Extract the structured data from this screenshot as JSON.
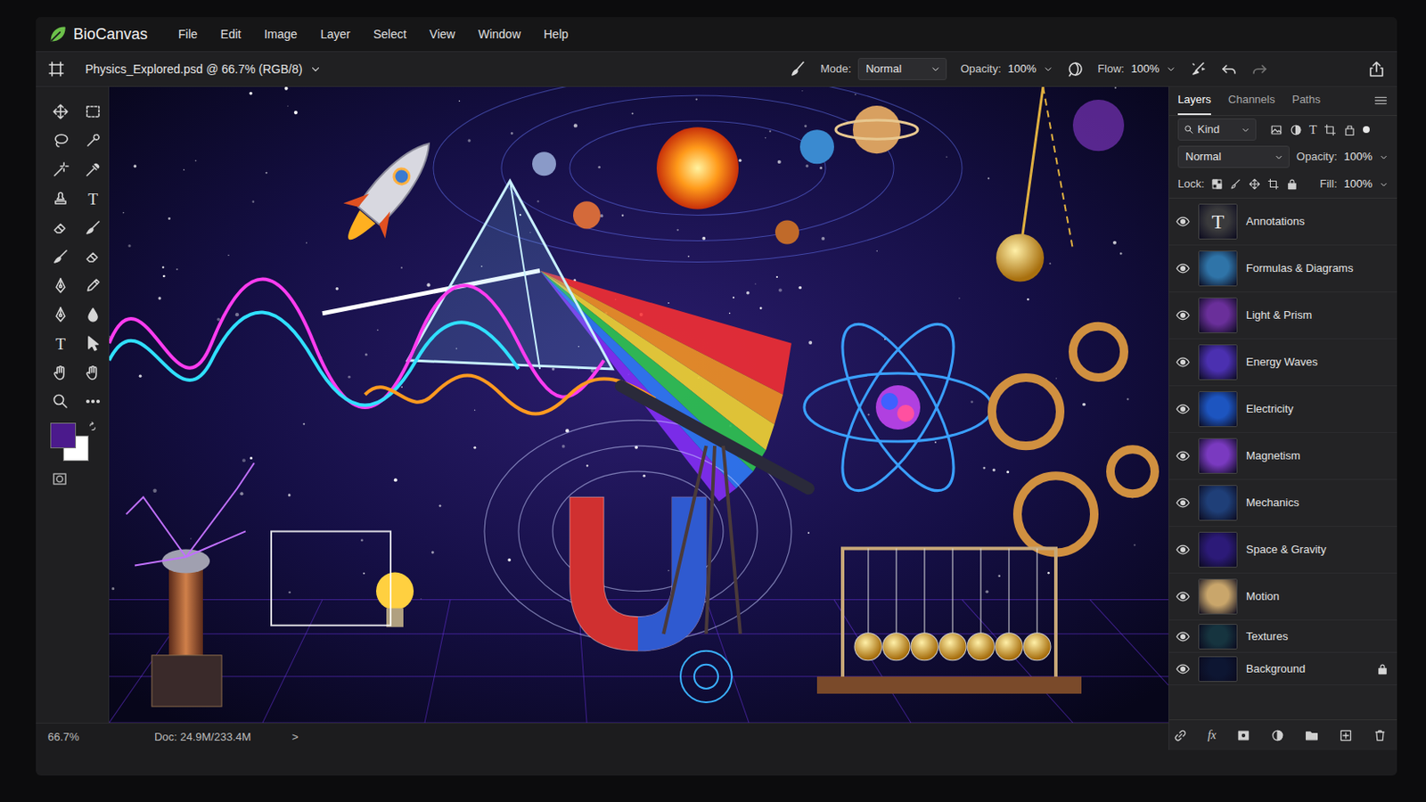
{
  "app": {
    "name": "BioCanvas"
  },
  "menu": [
    "File",
    "Edit",
    "Image",
    "Layer",
    "Select",
    "View",
    "Window",
    "Help"
  ],
  "options_bar": {
    "document_title": "Physics_Explored.psd @ 66.7% (RGB/8)",
    "mode_label": "Mode:",
    "mode": "Normal",
    "opacity_label": "Opacity:",
    "opacity": "100%",
    "flow_label": "Flow:",
    "flow": "100%"
  },
  "tools": [
    {
      "kind": "move"
    },
    {
      "kind": "marquee"
    },
    {
      "kind": "lasso"
    },
    {
      "kind": "quickselect"
    },
    {
      "kind": "wand"
    },
    {
      "kind": "eyedropper"
    },
    {
      "kind": "stamp"
    },
    {
      "kind": "type",
      "glyph": "T"
    },
    {
      "kind": "eraser"
    },
    {
      "kind": "brush"
    },
    {
      "kind": "brush"
    },
    {
      "kind": "eraser"
    },
    {
      "kind": "pen"
    },
    {
      "kind": "pencil"
    },
    {
      "kind": "pen"
    },
    {
      "kind": "fill"
    },
    {
      "kind": "type",
      "glyph": "T"
    },
    {
      "kind": "arrow"
    },
    {
      "kind": "hand"
    },
    {
      "kind": "hand"
    },
    {
      "kind": "zoom"
    },
    {
      "kind": "more"
    }
  ],
  "colors": {
    "foreground": "#4b1a8c",
    "background": "#ffffff"
  },
  "layers_panel": {
    "tabs": [
      {
        "label": "Layers",
        "selected": true
      },
      {
        "label": "Channels",
        "selected": false
      },
      {
        "label": "Paths",
        "selected": false
      }
    ],
    "filter": "Kind",
    "text_filter_glyph": "T",
    "blend_mode": "Normal",
    "opacity_label": "Opacity:",
    "opacity": "100%",
    "lock_label": "Lock:",
    "fill_label": "Fill:",
    "fill": "100%",
    "layers": [
      {
        "name": "Annotations",
        "visible": true,
        "locked": false,
        "selected": false,
        "thumb_glyph": "T",
        "color": "#3a3a3c"
      },
      {
        "name": "Formulas & Diagrams",
        "visible": true,
        "locked": false,
        "selected": false,
        "color": "#2f74a8"
      },
      {
        "name": "Light & Prism",
        "visible": true,
        "locked": false,
        "selected": false,
        "color": "#6a2f9a"
      },
      {
        "name": "Energy Waves",
        "visible": true,
        "locked": false,
        "selected": false,
        "color": "#4b30b0"
      },
      {
        "name": "Electricity",
        "visible": true,
        "locked": false,
        "selected": false,
        "color": "#1d55c0"
      },
      {
        "name": "Magnetism",
        "visible": true,
        "locked": false,
        "selected": false,
        "color": "#7a3ac0"
      },
      {
        "name": "Mechanics",
        "visible": true,
        "locked": false,
        "selected": false,
        "color": "#1f3f78"
      },
      {
        "name": "Space & Gravity",
        "visible": true,
        "locked": false,
        "selected": false,
        "color": "#2c1a78"
      },
      {
        "name": "Motion",
        "visible": true,
        "locked": false,
        "selected": false,
        "color": "#c9a66b"
      },
      {
        "name": "Textures",
        "visible": true,
        "locked": false,
        "selected": false,
        "color": "#16343f"
      },
      {
        "name": "Background",
        "visible": true,
        "locked": true,
        "selected": false,
        "color": "#0d1632"
      }
    ],
    "footer_fx": "fx"
  },
  "status_bar": {
    "zoom": "66.7%",
    "doc": "Doc: 24.9M/233.4M",
    "arrow": ">"
  }
}
